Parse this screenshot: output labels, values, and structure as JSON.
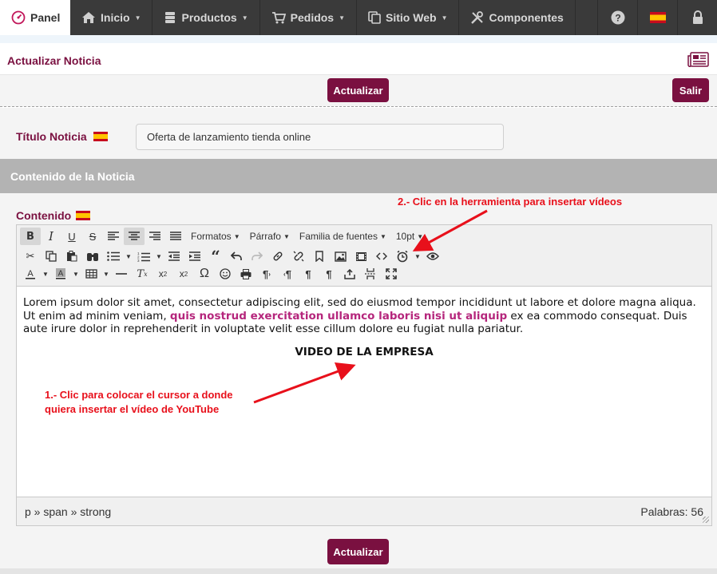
{
  "nav": {
    "panel": "Panel",
    "items": [
      {
        "label": "Inicio",
        "icon": "home-icon"
      },
      {
        "label": "Productos",
        "icon": "database-icon"
      },
      {
        "label": "Pedidos",
        "icon": "cart-icon"
      },
      {
        "label": "Sitio Web",
        "icon": "copy-icon"
      },
      {
        "label": "Componentes",
        "icon": "tools-icon"
      }
    ],
    "right_icons": [
      "help-icon",
      "flag-es-icon",
      "lock-icon"
    ]
  },
  "page": {
    "title": "Actualizar Noticia",
    "update_label": "Actualizar",
    "exit_label": "Salir"
  },
  "form": {
    "title_label": "Título Noticia",
    "title_value": "Oferta de lanzamiento tienda online",
    "section_title": "Contenido de la Noticia",
    "content_label": "Contenido"
  },
  "editor": {
    "dropdowns": {
      "formats": "Formatos",
      "paragraph": "Párrafo",
      "font_family": "Familia de fuentes",
      "font_size": "10pt"
    },
    "body_part1": "Lorem ipsum dolor sit amet, consectetur adipiscing elit, sed do eiusmod tempor incididunt ut labore et dolore magna aliqua. Ut enim ad minim veniam, ",
    "body_strong": "quis nostrud exercitation ullamco laboris nisi ut aliquip",
    "body_part2": " ex ea commodo consequat. Duis aute irure dolor in reprehenderit in voluptate velit esse cillum dolore eu fugiat nulla pariatur.",
    "heading": "VIDEO DE LA EMPRESA",
    "path": "p » span » strong",
    "word_count": "Palabras: 56"
  },
  "annotations": {
    "note1_line1": "1.- Clic para colocar el cursor a donde",
    "note1_line2": "quiera insertar el vídeo de YouTube",
    "note2": "2.- Clic en la herramienta para insertar vídeos"
  },
  "colors": {
    "brand": "#7a1040",
    "annotation": "#e8101b",
    "strong_text": "#b5267c"
  }
}
